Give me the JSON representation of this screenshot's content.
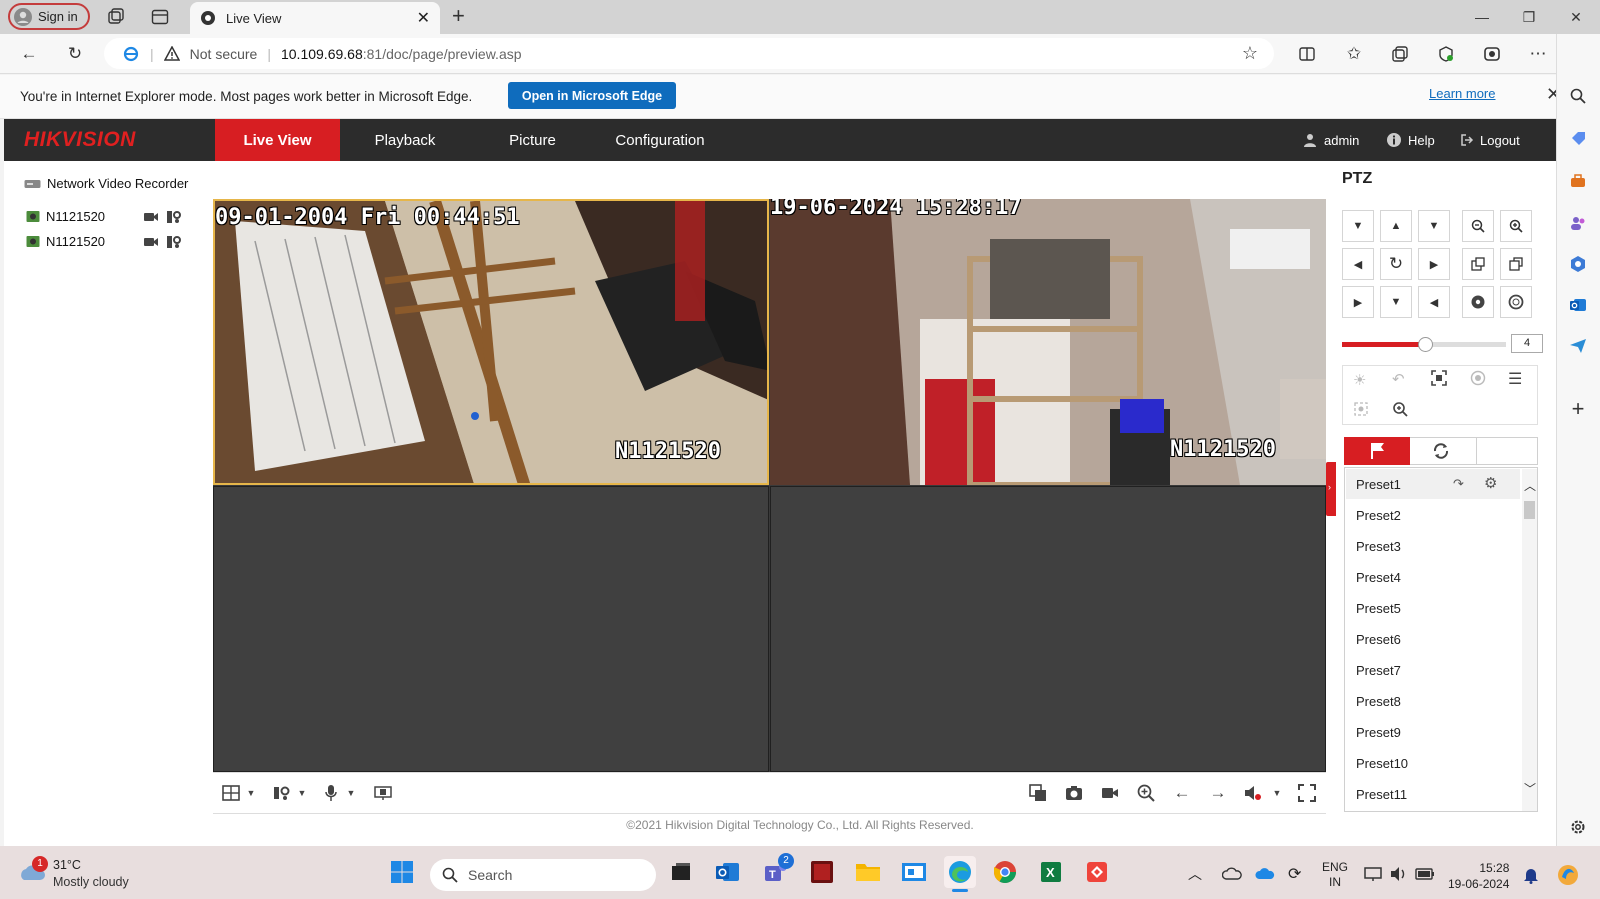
{
  "browser": {
    "signin_label": "Sign in",
    "tab_title": "Live View",
    "security_label": "Not secure",
    "url_host": "10.109.69.68",
    "url_rest": ":81/doc/page/preview.asp",
    "ie_message": "You're in Internet Explorer mode. Most pages work better in Microsoft Edge.",
    "open_edge_label": "Open in Microsoft Edge",
    "learn_more_label": "Learn more"
  },
  "app": {
    "logo": "HIKVISION",
    "nav": [
      "Live View",
      "Playback",
      "Picture",
      "Configuration"
    ],
    "user_label": "admin",
    "help_label": "Help",
    "logout_label": "Logout",
    "brand_color": "#d71e22"
  },
  "device_tree": {
    "root": "Network Video Recorder",
    "channels": [
      "N1121520",
      "N1121520"
    ]
  },
  "video": {
    "cam1": {
      "timestamp": "09-01-2004 Fri 00:44:51",
      "name": "N1121520"
    },
    "cam2": {
      "timestamp": "19-06-2024 15:28:17",
      "name": "N1121520"
    }
  },
  "ptz": {
    "title": "PTZ",
    "speed": "4",
    "speed_level_fraction": 0.5,
    "presets": [
      "Preset1",
      "Preset2",
      "Preset3",
      "Preset4",
      "Preset5",
      "Preset6",
      "Preset7",
      "Preset8",
      "Preset9",
      "Preset10",
      "Preset11"
    ]
  },
  "footer": {
    "copyright": "©2021 Hikvision Digital Technology Co., Ltd. All Rights Reserved."
  },
  "taskbar": {
    "weather_temp": "31°C",
    "weather_desc": "Mostly cloudy",
    "weather_badge": "1",
    "search_placeholder": "Search",
    "teams_badge": "2",
    "lang_line1": "ENG",
    "lang_line2": "IN",
    "time": "15:28",
    "date": "19-06-2024"
  }
}
